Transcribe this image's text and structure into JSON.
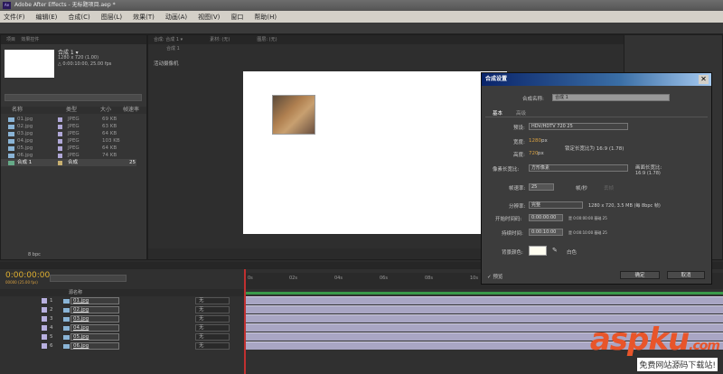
{
  "app": {
    "title": "Adobe After Effects - 无标题项目.aep *",
    "logo": "Ae"
  },
  "menu": [
    "文件(F)",
    "编辑(E)",
    "合成(C)",
    "图层(L)",
    "效果(T)",
    "动画(A)",
    "视图(V)",
    "窗口",
    "帮助(H)"
  ],
  "project": {
    "tabs": [
      "项目",
      "效果控件"
    ],
    "comp_name": "合成 1 ▾",
    "comp_size": "1280 x 720 (1.00)",
    "comp_duration": "△ 0:00:10:00, 25.00 fps",
    "columns": [
      "名称",
      "类型",
      "大小",
      "帧速率"
    ],
    "items": [
      {
        "name": "01.jpg",
        "type": "JPEG",
        "size": "69 KB",
        "fps": ""
      },
      {
        "name": "02.jpg",
        "type": "JPEG",
        "size": "63 KB",
        "fps": ""
      },
      {
        "name": "03.jpg",
        "type": "JPEG",
        "size": "64 KB",
        "fps": ""
      },
      {
        "name": "04.jpg",
        "type": "JPEG",
        "size": "103 KB",
        "fps": ""
      },
      {
        "name": "05.jpg",
        "type": "JPEG",
        "size": "64 KB",
        "fps": ""
      },
      {
        "name": "06.jpg",
        "type": "JPEG",
        "size": "74 KB",
        "fps": ""
      },
      {
        "name": "合成 1",
        "type": "合成",
        "size": "",
        "fps": "25"
      }
    ],
    "bpc": "8 bpc"
  },
  "viewer": {
    "tabs": [
      "合成: 合成 1 ▾",
      "素材: (无)",
      "图层: (无)"
    ],
    "subtab": "合成 1",
    "camera": "活动摄像机"
  },
  "timeline": {
    "timecode": "0:00:00:00",
    "frame_info": "00000 (25.00 fps)",
    "header_name": "源名称",
    "ruler": [
      "0s",
      "02s",
      "04s",
      "06s",
      "08s",
      "10s"
    ],
    "layers": [
      {
        "num": "1",
        "name": "01.jpg",
        "parent": "无"
      },
      {
        "num": "2",
        "name": "02.jpg",
        "parent": "无"
      },
      {
        "num": "3",
        "name": "03.jpg",
        "parent": "无"
      },
      {
        "num": "4",
        "name": "04.jpg",
        "parent": "无"
      },
      {
        "num": "5",
        "name": "05.jpg",
        "parent": "无"
      },
      {
        "num": "6",
        "name": "06.jpg",
        "parent": "无"
      }
    ]
  },
  "dialog": {
    "title": "合成设置",
    "name_label": "合成名称:",
    "name_value": "合成 1",
    "tabs": [
      "基本",
      "高级"
    ],
    "preset_label": "预设:",
    "preset_value": "HDV/HDTV 720 25",
    "width_label": "宽度:",
    "width_value": "1280",
    "height_label": "高度:",
    "height_value": "720",
    "px": "px",
    "lock_label": "锁定长宽比为 16:9 (1.78)",
    "pixel_aspect_label": "像素长宽比:",
    "pixel_aspect_value": "方形像素",
    "frame_aspect_label": "画面长宽比:",
    "frame_aspect_value": "16:9 (1.78)",
    "fps_label": "帧速率:",
    "fps_value": "25",
    "fps_unit": "帧/秒",
    "drop_frame": "丢帧",
    "resolution_label": "分辨率:",
    "resolution_value": "完整",
    "resolution_info": "1280 x 720, 3.5 MB (每 8bpc 帧)",
    "start_label": "开始时间码:",
    "start_value": "0:00:00:00",
    "start_info": "是 0:00:00:00  基础 25",
    "duration_label": "持续时间:",
    "duration_value": "0:00:10:00",
    "duration_info": "是 0:00:10:00  基础 25",
    "bg_label": "背景颜色:",
    "bg_name": "白色",
    "preview": "预览",
    "ok": "确定",
    "cancel": "取消"
  },
  "watermark": {
    "main": "aspku.com",
    "sub": "免费网站源码下载站!"
  }
}
